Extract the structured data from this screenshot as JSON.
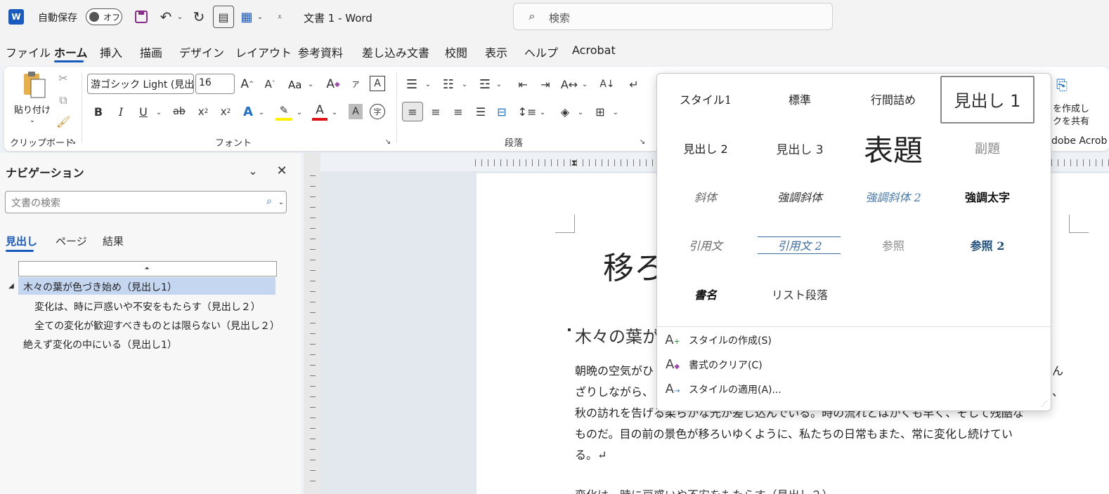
{
  "titlebar": {
    "autosave_label": "自動保存",
    "autosave_state": "オフ",
    "doc_title": "文書 1 - Word",
    "search_placeholder": "検索"
  },
  "menu_tabs": [
    "ファイル",
    "ホーム",
    "挿入",
    "描画",
    "デザイン",
    "レイアウト",
    "参考資料",
    "差し込み文書",
    "校閲",
    "表示",
    "ヘルプ",
    "Acrobat"
  ],
  "ribbon": {
    "clipboard": {
      "paste_label": "貼り付け",
      "group_label": "クリップボード"
    },
    "font": {
      "font_name": "游ゴシック Light (見出",
      "font_size": "16",
      "change_case": "Aa",
      "group_label": "フォント"
    },
    "paragraph": {
      "group_label": "段落"
    },
    "acrobat": {
      "create_share_line1": "を作成し",
      "create_share_line2": "クを共有",
      "adobe_label": "dobe Acrob"
    }
  },
  "navigation": {
    "title": "ナビゲーション",
    "search_placeholder": "文書の検索",
    "tabs": [
      "見出し",
      "ページ",
      "結果"
    ],
    "headings": [
      {
        "text": "木々の葉が色づき始め（見出し1）",
        "level": 1,
        "selected": true
      },
      {
        "text": "変化は、時に戸惑いや不安をもたらす（見出し２）",
        "level": 2,
        "selected": false
      },
      {
        "text": "全ての変化が歓迎すべきものとは限らない（見出し２）",
        "level": 2,
        "selected": false
      },
      {
        "text": "絶えず変化の中にいる（見出し1）",
        "level": 1,
        "selected": false
      }
    ]
  },
  "document": {
    "title_partial": "移ろ",
    "heading1_partial": "木々の葉が",
    "body_lines": [
      "朝晩の空気がひ",
      "ざりしながら、",
      "秋の訪れを告げる柔らかな光が差し込んでいる。時の流れとはかくも早く、そして残酷な",
      "ものだ。目の前の景色が移ろいゆくように、私たちの日常もまた、常に変化し続けてい",
      "る。↵"
    ],
    "right_fragments": [
      "ん",
      "、"
    ],
    "bottom_partial": "変化は、時に戸惑いや不安をもたらす（見出し２）"
  },
  "style_gallery": {
    "styles": [
      [
        "スタイル1",
        "標準",
        "行間詰め",
        "見出し 1"
      ],
      [
        "見出し 2",
        "見出し 3",
        "表題",
        "副題"
      ],
      [
        "斜体",
        "強調斜体",
        "強調斜体 2",
        "強調太字"
      ],
      [
        "引用文",
        "引用文 2",
        "参照",
        "参照 2"
      ],
      [
        "書名",
        "リスト段落"
      ]
    ],
    "commands": [
      "スタイルの作成(S)",
      "書式のクリア(C)",
      "スタイルの適用(A)..."
    ]
  },
  "colors": {
    "accent": "#185abd",
    "nav_selected": "#c5d7f0",
    "word_blue": "#185abd"
  }
}
